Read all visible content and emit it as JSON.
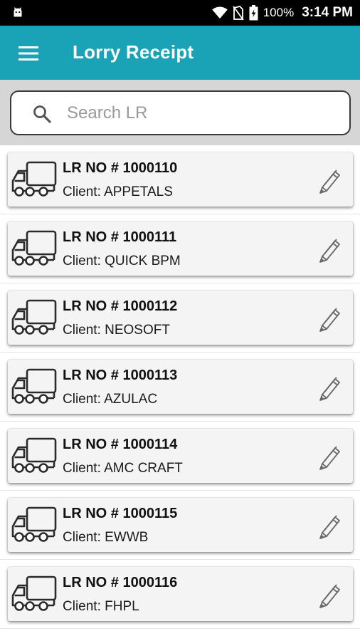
{
  "status_bar": {
    "icons": [
      "android-icon",
      "wifi-icon",
      "no-sim-icon",
      "battery-charging-icon"
    ],
    "battery": "100%",
    "time": "3:14 PM"
  },
  "app_bar": {
    "menu_icon": "hamburger-menu-icon",
    "title": "Lorry Receipt"
  },
  "search": {
    "icon": "search-icon",
    "placeholder": "Search LR",
    "value": ""
  },
  "list": {
    "item_icon": "truck-icon",
    "action_icon": "edit-pencil-icon",
    "items": [
      {
        "lr": "LR NO # 1000110",
        "client": "Client: APPETALS"
      },
      {
        "lr": "LR NO # 1000111",
        "client": "Client: QUICK BPM"
      },
      {
        "lr": "LR NO # 1000112",
        "client": "Client: NEOSOFT"
      },
      {
        "lr": "LR NO # 1000113",
        "client": "Client: AZULAC"
      },
      {
        "lr": "LR NO # 1000114",
        "client": "Client: AMC CRAFT"
      },
      {
        "lr": "LR NO # 1000115",
        "client": "Client: EWWB"
      },
      {
        "lr": "LR NO # 1000116",
        "client": "Client: FHPL"
      }
    ]
  },
  "colors": {
    "app_bar": "#1aa3b7",
    "status_bar": "#000000",
    "search_area": "#d6d6d6",
    "card": "#f4f4f4"
  }
}
